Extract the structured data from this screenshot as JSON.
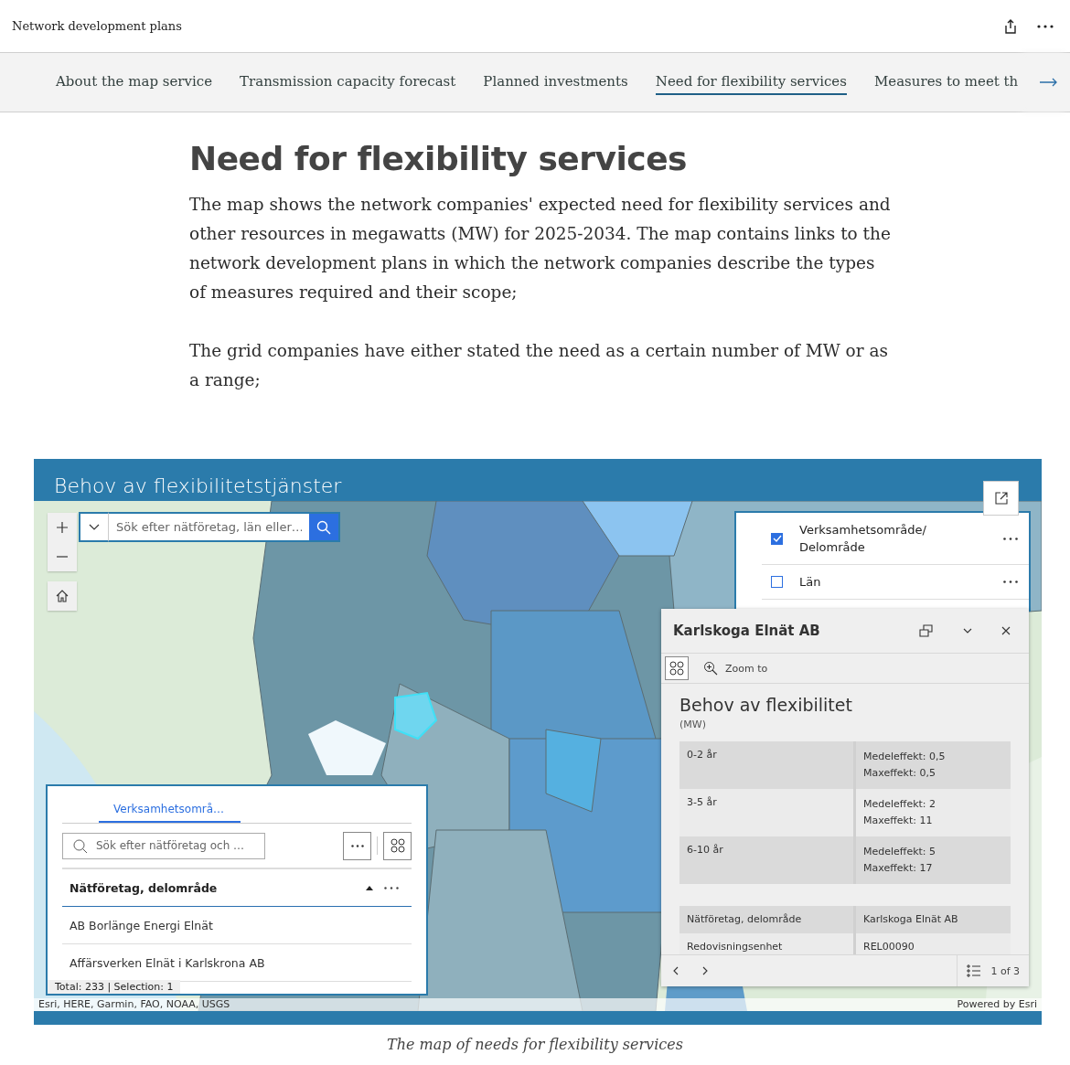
{
  "header": {
    "title": "Network development plans"
  },
  "nav": {
    "tabs": [
      {
        "label": "About the map service",
        "selected": false
      },
      {
        "label": "Transmission capacity forecast",
        "selected": false
      },
      {
        "label": "Planned investments",
        "selected": false
      },
      {
        "label": "Need for flexibility services",
        "selected": true
      },
      {
        "label": "Measures to meet th",
        "selected": false
      }
    ]
  },
  "article": {
    "heading": "Need for flexibility services",
    "paragraphs": [
      "The map shows the network companies' expected need for flexibility services and other resources in megawatts (MW) for 2025-2034. The map contains links to the network development plans in which the network companies describe the types of measures required and their scope;",
      "The grid companies have either stated the need as a certain number of MW or as a range;"
    ]
  },
  "map_embed": {
    "title": "Behov av flexibilitetstjänster",
    "search": {
      "placeholder": "Sök efter nätföretag, län eller…"
    },
    "layers": [
      {
        "label": "Verksamhetsområde/ Delområde",
        "checked": true
      },
      {
        "label": "Län",
        "checked": false
      }
    ],
    "popup": {
      "title": "Karlskoga Elnät AB",
      "action": "Zoom to",
      "heading": "Behov av flexibilitet",
      "subheading": "(MW)",
      "rows": [
        {
          "period": "0-2 år",
          "values": [
            "Medeleffekt: 0,5",
            "Maxeffekt: 0,5"
          ]
        },
        {
          "period": "3-5 år",
          "values": [
            "Medeleffekt: 2",
            "Maxeffekt: 11"
          ]
        },
        {
          "period": "6-10 år",
          "values": [
            "Medeleffekt: 5",
            "Maxeffekt: 17"
          ]
        }
      ],
      "fields": [
        {
          "label": "Nätföretag, delområde",
          "value": "Karlskoga Elnät AB"
        },
        {
          "label": "Redovisningsenhet",
          "value": "REL00090"
        }
      ],
      "pager": "1 of 3"
    },
    "table": {
      "tabs": [
        {
          "label": "Verksamhetsområ…",
          "selected": true
        }
      ],
      "search": {
        "placeholder": "Sök efter nätföretag och …"
      },
      "column": "Nätföretag, delområde",
      "rows": [
        "AB Borlänge Energi Elnät",
        "Affärsverken Elnät i Karlskrona AB"
      ],
      "summary": "Total: 233 | Selection: 1"
    },
    "attribution": "Esri, HERE, Garmin, FAO, NOAA, USGS",
    "powered_by": "Powered by Esri"
  },
  "caption": "The map of needs for flexibility services"
}
